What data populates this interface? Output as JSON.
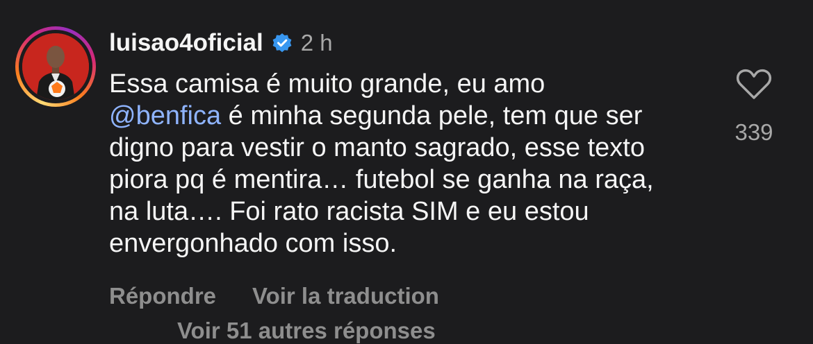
{
  "comment": {
    "username": "luisao4oficial",
    "time": "2 h",
    "mention": "@benfica",
    "text_before": "Essa camisa é muito grande, eu amo",
    "text_after": " é minha segunda pele, tem que ser digno para vestir o manto sagrado, esse texto piora pq é mentira… futebol se ganha na raça, na luta…. Foi rato racista SIM e eu estou envergonhado com isso.",
    "like_count": "339",
    "reply_label": "Répondre",
    "translate_label": "Voir la traduction",
    "more_replies_label": "Voir 51 autres réponses"
  },
  "colors": {
    "background": "#1c1c1e",
    "mention": "#8fb4ff",
    "verified": "#3897f0",
    "secondary_text": "#8e8e8e"
  },
  "icons": [
    "verified-badge-icon",
    "heart-icon"
  ]
}
